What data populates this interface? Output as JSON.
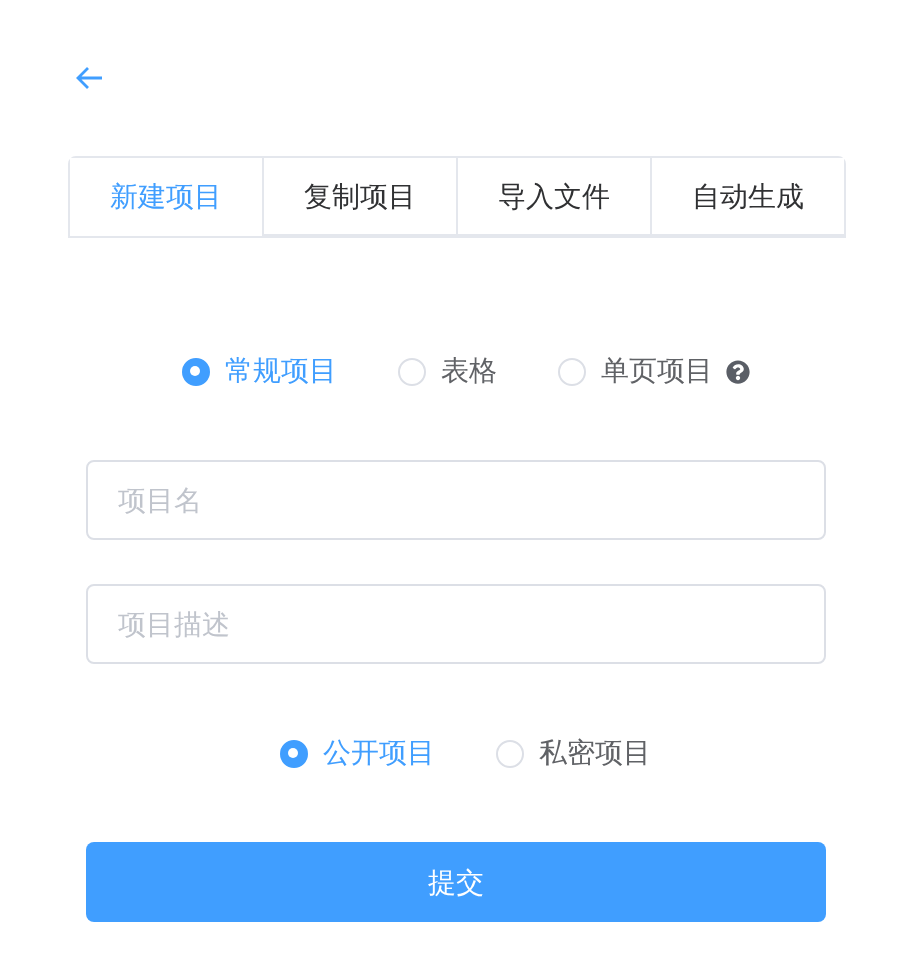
{
  "tabs": [
    {
      "label": "新建项目",
      "selected": true
    },
    {
      "label": "复制项目",
      "selected": false
    },
    {
      "label": "导入文件",
      "selected": false
    },
    {
      "label": "自动生成",
      "selected": false
    }
  ],
  "project_type": [
    {
      "label": "常规项目",
      "selected": true,
      "help": false
    },
    {
      "label": "表格",
      "selected": false,
      "help": false
    },
    {
      "label": "单页项目",
      "selected": false,
      "help": true
    }
  ],
  "fields": [
    {
      "placeholder": "项目名"
    },
    {
      "placeholder": "项目描述"
    }
  ],
  "visibility": [
    {
      "label": "公开项目",
      "selected": true
    },
    {
      "label": "私密项目",
      "selected": false
    }
  ],
  "submit": "提交"
}
